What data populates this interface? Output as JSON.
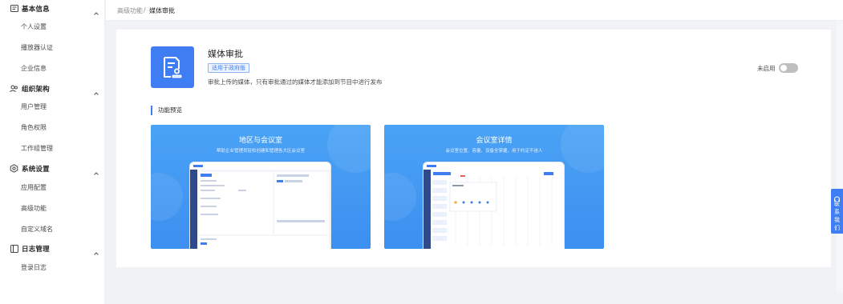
{
  "sidebar": {
    "groups": [
      {
        "label": "基本信息",
        "icon": "id-card-icon",
        "items": [
          "个人设置",
          "播放器认证",
          "企业信息"
        ]
      },
      {
        "label": "组织架构",
        "icon": "users-icon",
        "items": [
          "用户管理",
          "角色权限",
          "工作组管理"
        ]
      },
      {
        "label": "系统设置",
        "icon": "settings-hex-icon",
        "items": [
          "应用配置",
          "高级功能",
          "自定义域名"
        ]
      },
      {
        "label": "日志管理",
        "icon": "log-icon",
        "items": [
          "登录日志"
        ]
      }
    ]
  },
  "breadcrumb": {
    "parent": "高级功能",
    "separator": "/",
    "current": "媒体审批"
  },
  "app": {
    "title": "媒体审批",
    "badge": "适用于政府版",
    "description": "审批上传的媒体，只有审批通过的媒体才能添加到节目中进行发布",
    "status_label": "未启用",
    "enabled": false,
    "icon": "document-approval-icon"
  },
  "preview_section": {
    "heading": "功能预览",
    "cards": [
      {
        "title": "地区与会议室",
        "subtitle": "帮助企业管理员轻松创建和管理各大区会议室"
      },
      {
        "title": "会议室详情",
        "subtitle": "会议室位置、容量、设备全掌握，用于约定不迷人"
      }
    ]
  },
  "float_help": {
    "label": "联系我们",
    "icon": "headset-icon"
  },
  "colors": {
    "accent": "#3e7ef2",
    "toggle_off": "#bfbfbf",
    "preview_bg": "#4aa3f5"
  }
}
